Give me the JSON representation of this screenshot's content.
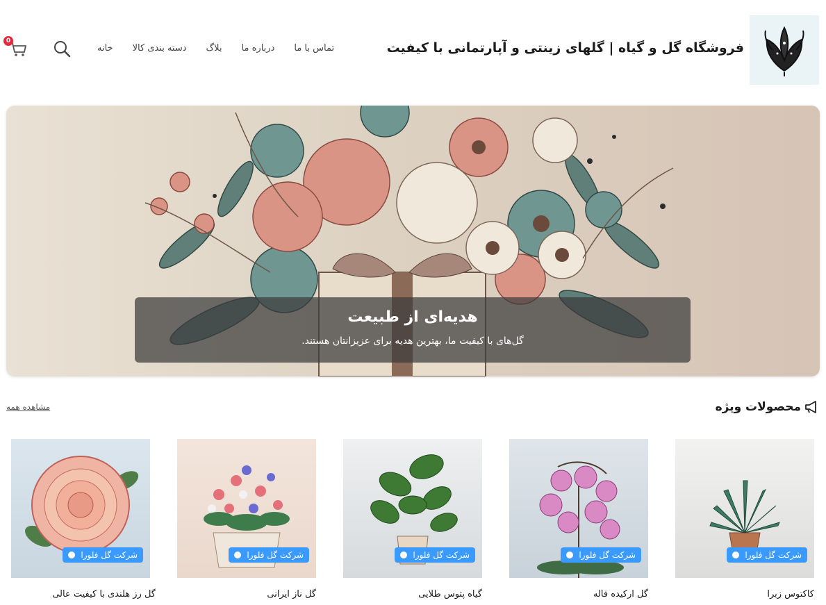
{
  "header": {
    "site_title": "فروشگاه گل و گیاه | گلهای زینتی و آپارتمانی با کیفیت",
    "nav": [
      "خانه",
      "دسته بندی کالا",
      "بلاگ",
      "درباره ما",
      "تماس با ما"
    ],
    "cart_count": "0",
    "icons": {
      "logo": "lotus-logo-icon",
      "search": "search-icon",
      "cart": "cart-icon"
    }
  },
  "hero": {
    "title": "هدیه‌ای از طبیعت",
    "subtitle": "گل‌های با کیفیت ما، بهترین هدیه برای عزیزانتان هستند."
  },
  "featured": {
    "title": "محصولات ویژه",
    "icon": "megaphone-icon",
    "view_all": "مشاهده همه"
  },
  "products": [
    {
      "name": "کاکتوس زبرا",
      "badge": "شرکت گل فلورا"
    },
    {
      "name": "گل ارکیده فاله",
      "badge": "شرکت گل فلورا"
    },
    {
      "name": "گیاه پتوس طلایی",
      "badge": "شرکت گل فلورا"
    },
    {
      "name": "گل ناز ایرانی",
      "badge": "شرکت گل فلورا"
    },
    {
      "name": "گل رز هلندی با کیفیت عالی",
      "badge": "شرکت گل فلورا"
    }
  ],
  "colors": {
    "badge": "#3b9aff",
    "cart_badge": "#e6283c",
    "logo_bg": "#eaf4f6"
  }
}
